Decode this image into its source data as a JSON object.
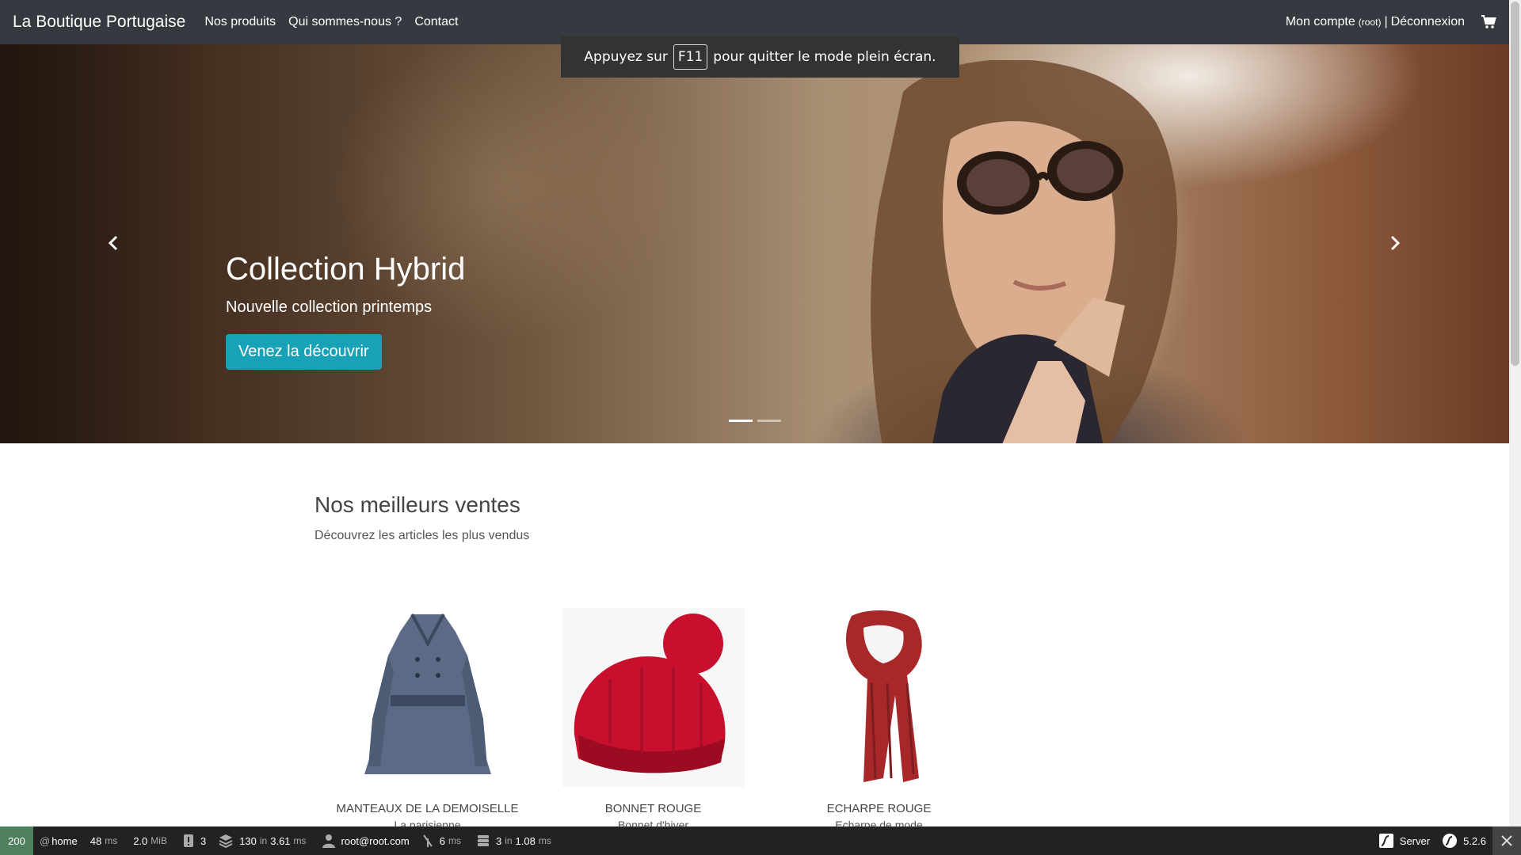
{
  "navbar": {
    "brand": "La Boutique Portugaise",
    "links": [
      "Nos produits",
      "Qui sommes-nous ?",
      "Contact"
    ],
    "account": "Mon compte",
    "account_user": "(root)",
    "separator": "|",
    "logout": "Déconnexion"
  },
  "fullscreen_notice": {
    "before": "Appuyez sur",
    "key": "F11",
    "after": "pour quitter le mode plein écran."
  },
  "hero": {
    "title": "Collection Hybrid",
    "subtitle": "Nouvelle collection printemps",
    "button": "Venez la découvrir",
    "slides": 2,
    "active_slide": 1
  },
  "bestsellers": {
    "title": "Nos meilleurs ventes",
    "subtitle": "Découvrez les articles les plus vendus",
    "products": [
      {
        "name": "MANTEAUX DE LA DEMOISELLE",
        "desc": "La parisienne",
        "icon": "coat-image"
      },
      {
        "name": "BONNET ROUGE",
        "desc": "Bonnet d'hiver",
        "icon": "beanie-image"
      },
      {
        "name": "ECHARPE ROUGE",
        "desc": "Echarpe de mode",
        "icon": "scarf-image"
      }
    ]
  },
  "toolbar": {
    "status": "200",
    "route_prefix": "@",
    "route": "home",
    "time_value": "48",
    "time_unit": "ms",
    "memory_value": "2.0",
    "memory_unit": "MiB",
    "logs": "3",
    "twig_count": "130",
    "twig_in": "in",
    "twig_time": "3.61",
    "twig_unit": "ms",
    "user": "root@root.com",
    "cache_value": "6",
    "cache_unit": "ms",
    "db_count": "3",
    "db_in": "in",
    "db_time": "1.08",
    "db_unit": "ms",
    "server": "Server",
    "version": "5.2.6"
  },
  "colors": {
    "navbar": "#343a40",
    "accent_button": "#17a2b8",
    "status_ok": "#4f805d",
    "toolbar": "#222222"
  }
}
